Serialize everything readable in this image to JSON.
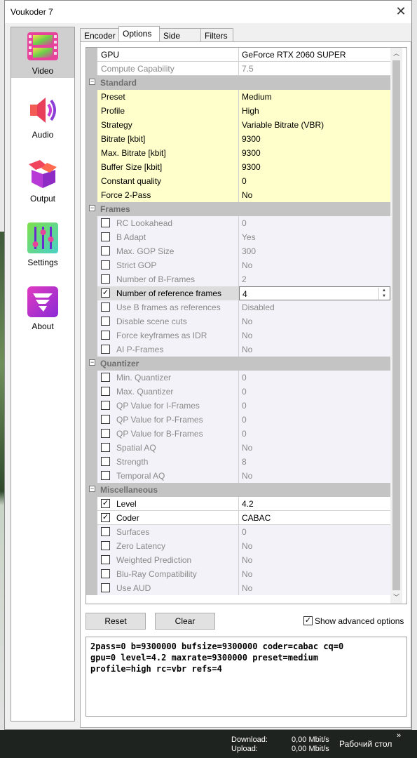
{
  "window": {
    "title": "Voukoder 7",
    "close_glyph": "✕"
  },
  "sidebar": [
    {
      "label": "Video",
      "icon": "film-strip-icon",
      "active": true
    },
    {
      "label": "Audio",
      "icon": "speaker-icon",
      "active": false
    },
    {
      "label": "Output",
      "icon": "package-box-icon",
      "active": false
    },
    {
      "label": "Settings",
      "icon": "sliders-icon",
      "active": false
    },
    {
      "label": "About",
      "icon": "tornado-logo-icon",
      "active": false
    }
  ],
  "tabs": [
    {
      "label": "Encoder",
      "active": false
    },
    {
      "label": "Options",
      "active": true
    },
    {
      "label": "Side data",
      "active": false
    },
    {
      "label": "Filters",
      "active": false
    }
  ],
  "grid": {
    "top": [
      {
        "name": "GPU",
        "value": "GeForce RTX 2060 SUPER",
        "style": "plain"
      },
      {
        "name": "Compute Capability",
        "value": "7.5",
        "style": "gray"
      }
    ],
    "categories": [
      {
        "name": "Standard",
        "rows": [
          {
            "name": "Preset",
            "value": "Medium",
            "style": "yellow"
          },
          {
            "name": "Profile",
            "value": "High",
            "style": "yellow"
          },
          {
            "name": "Strategy",
            "value": "Variable Bitrate (VBR)",
            "style": "yellow"
          },
          {
            "name": "Bitrate [kbit]",
            "value": "9300",
            "style": "yellow"
          },
          {
            "name": "Max. Bitrate [kbit]",
            "value": "9300",
            "style": "yellow"
          },
          {
            "name": "Buffer Size [kbit]",
            "value": "9300",
            "style": "yellow"
          },
          {
            "name": "Constant quality",
            "value": "0",
            "style": "yellow"
          },
          {
            "name": "Force 2-Pass",
            "value": "No",
            "style": "yellow"
          }
        ]
      },
      {
        "name": "Frames",
        "rows": [
          {
            "name": "RC Lookahead",
            "value": "0",
            "style": "lav",
            "checked": false
          },
          {
            "name": "B Adapt",
            "value": "Yes",
            "style": "lav",
            "checked": false
          },
          {
            "name": "Max. GOP Size",
            "value": "300",
            "style": "lav",
            "checked": false
          },
          {
            "name": "Strict GOP",
            "value": "No",
            "style": "lav",
            "checked": false
          },
          {
            "name": "Number of B-Frames",
            "value": "2",
            "style": "lav",
            "checked": false
          },
          {
            "name": "Number of reference frames",
            "value": "4",
            "style": "sel",
            "checked": true
          },
          {
            "name": "Use B frames as references",
            "value": "Disabled",
            "style": "lav",
            "checked": false
          },
          {
            "name": "Disable scene cuts",
            "value": "No",
            "style": "lav",
            "checked": false
          },
          {
            "name": "Force keyframes as IDR",
            "value": "No",
            "style": "lav",
            "checked": false
          },
          {
            "name": "AI P-Frames",
            "value": "No",
            "style": "lav",
            "checked": false
          }
        ]
      },
      {
        "name": "Quantizer",
        "rows": [
          {
            "name": "Min. Quantizer",
            "value": "0",
            "style": "lav",
            "checked": false
          },
          {
            "name": "Max. Quantizer",
            "value": "0",
            "style": "lav",
            "checked": false
          },
          {
            "name": "QP Value for I-Frames",
            "value": "0",
            "style": "lav",
            "checked": false
          },
          {
            "name": "QP Value for P-Frames",
            "value": "0",
            "style": "lav",
            "checked": false
          },
          {
            "name": "QP Value for B-Frames",
            "value": "0",
            "style": "lav",
            "checked": false
          },
          {
            "name": "Spatial AQ",
            "value": "No",
            "style": "lav",
            "checked": false
          },
          {
            "name": "Strength",
            "value": "8",
            "style": "lav",
            "checked": false
          },
          {
            "name": "Temporal AQ",
            "value": "No",
            "style": "lav",
            "checked": false
          }
        ]
      },
      {
        "name": "Miscellaneous",
        "rows": [
          {
            "name": "Level",
            "value": "4.2",
            "style": "active",
            "checked": true
          },
          {
            "name": "Coder",
            "value": "CABAC",
            "style": "active",
            "checked": true
          },
          {
            "name": "Surfaces",
            "value": "0",
            "style": "lav",
            "checked": false
          },
          {
            "name": "Zero Latency",
            "value": "No",
            "style": "lav",
            "checked": false
          },
          {
            "name": "Weighted Prediction",
            "value": "No",
            "style": "lav",
            "checked": false
          },
          {
            "name": "Blu-Ray Compatibility",
            "value": "No",
            "style": "lav",
            "checked": false
          },
          {
            "name": "Use AUD",
            "value": "No",
            "style": "lav",
            "checked": false
          }
        ]
      }
    ]
  },
  "buttons": {
    "reset": "Reset",
    "clear": "Clear"
  },
  "advanced": {
    "label": "Show advanced options",
    "checked": true
  },
  "command_line": "2pass=0 b=9300000 bufsize=9300000 coder=cabac cq=0\ngpu=0 level=4.2 maxrate=9300000 preset=medium\nprofile=high rc=vbr refs=4",
  "taskbar": {
    "download_label": "Download:",
    "upload_label": "Upload:",
    "download_value": "0,00 Mbit/s",
    "upload_value": "0,00 Mbit/s",
    "desktop_label": "Рабочий стол",
    "chevron": "»"
  },
  "colors": {
    "yellow_row": "#ffffcc",
    "category_bg": "#c4c4c4",
    "selected_sidebar": "#cfcfcf"
  }
}
